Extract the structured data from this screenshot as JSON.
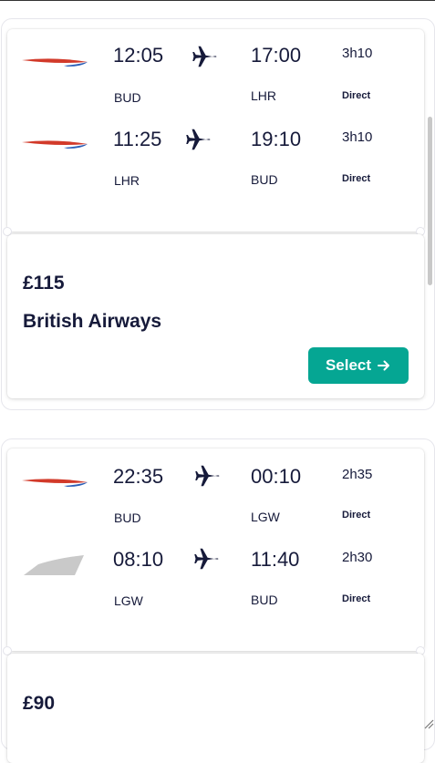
{
  "results": [
    {
      "legs": [
        {
          "depart_time": "12:05",
          "depart_code": "BUD",
          "arrive_time": "17:00",
          "arrive_code": "LHR",
          "duration": "3h10",
          "stops": "Direct",
          "logo": "british-airways-logo"
        },
        {
          "depart_time": "11:25",
          "depart_code": "LHR",
          "arrive_time": "19:10",
          "arrive_code": "BUD",
          "duration": "3h10",
          "stops": "Direct",
          "logo": "british-airways-logo"
        }
      ],
      "price": "£115",
      "airline": "British Airways",
      "select_label": "Select"
    },
    {
      "legs": [
        {
          "depart_time": "22:35",
          "depart_code": "BUD",
          "arrive_time": "00:10",
          "arrive_code": "LGW",
          "duration": "2h35",
          "stops": "Direct",
          "logo": "british-airways-logo"
        },
        {
          "depart_time": "08:10",
          "depart_code": "LGW",
          "arrive_time": "11:40",
          "arrive_code": "BUD",
          "duration": "2h30",
          "stops": "Direct",
          "logo": "generic-airline-logo"
        }
      ],
      "price": "£90"
    }
  ],
  "icons": {
    "plane": "plane-icon",
    "arrow": "arrow-right-icon"
  },
  "colors": {
    "select_button": "#05a693",
    "text": "#161a3a",
    "ba_red": "#d23a2a",
    "ba_blue": "#2b5fb8"
  }
}
